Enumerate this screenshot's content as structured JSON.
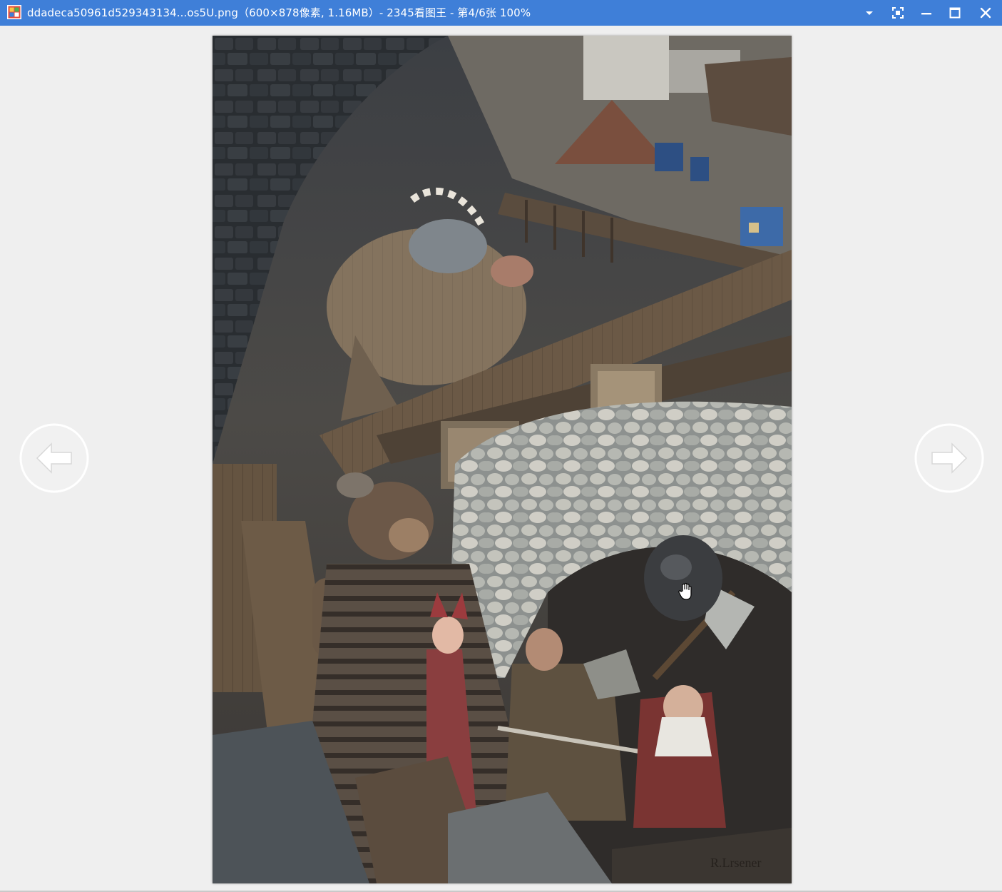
{
  "window": {
    "title": "ddadeca50961d529343134...os5U.png（600×878像素, 1.16MB）- 2345看图王 - 第4/6张 100%"
  },
  "titlebar_controls": [
    {
      "name": "menu-dropdown",
      "icon": "chevron-down-icon"
    },
    {
      "name": "fullscreen",
      "icon": "fullscreen-icon"
    },
    {
      "name": "minimize",
      "icon": "minimize-icon"
    },
    {
      "name": "maximize",
      "icon": "maximize-icon"
    },
    {
      "name": "close",
      "icon": "close-icon"
    }
  ],
  "navigation": {
    "prev_icon": "arrow-left-icon",
    "next_icon": "arrow-right-icon"
  },
  "image": {
    "signature_text": "R.Lrsener"
  },
  "colors": {
    "titlebar": "#3f7fd8",
    "background": "#efefef"
  }
}
